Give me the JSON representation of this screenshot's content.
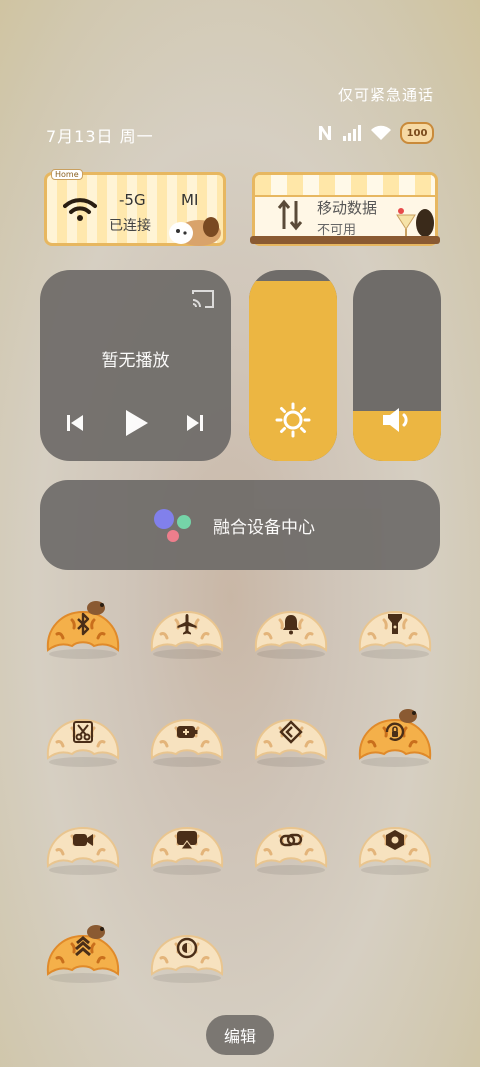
{
  "status": {
    "emergency_only": "仅可紧急通话",
    "date": "7月13日 周一",
    "battery": "100"
  },
  "wifi_card": {
    "ssid": "-5G",
    "ssid_extra": "MI",
    "status": "已连接",
    "tag": "Home"
  },
  "mobile_card": {
    "title": "移动数据",
    "status": "不可用"
  },
  "media": {
    "title": "暂无播放"
  },
  "brightness": {
    "level": 0.94
  },
  "volume": {
    "level": 0.26
  },
  "fusion": {
    "label": "融合设备中心"
  },
  "toggles": [
    {
      "name": "bluetooth-icon",
      "active": true
    },
    {
      "name": "airplane-icon",
      "active": false
    },
    {
      "name": "bell-icon",
      "active": false
    },
    {
      "name": "flashlight-icon",
      "active": false
    },
    {
      "name": "screenshot-icon",
      "active": false
    },
    {
      "name": "battery-saver-icon",
      "active": false
    },
    {
      "name": "nearby-share-icon",
      "active": false
    },
    {
      "name": "rotation-lock-icon",
      "active": true
    },
    {
      "name": "screen-record-icon",
      "active": false
    },
    {
      "name": "cast-icon",
      "active": false
    },
    {
      "name": "link-icon",
      "active": false
    },
    {
      "name": "settings-icon",
      "active": false
    },
    {
      "name": "performance-icon",
      "active": true
    },
    {
      "name": "dark-mode-icon",
      "active": false
    }
  ],
  "edit_label": "编辑"
}
